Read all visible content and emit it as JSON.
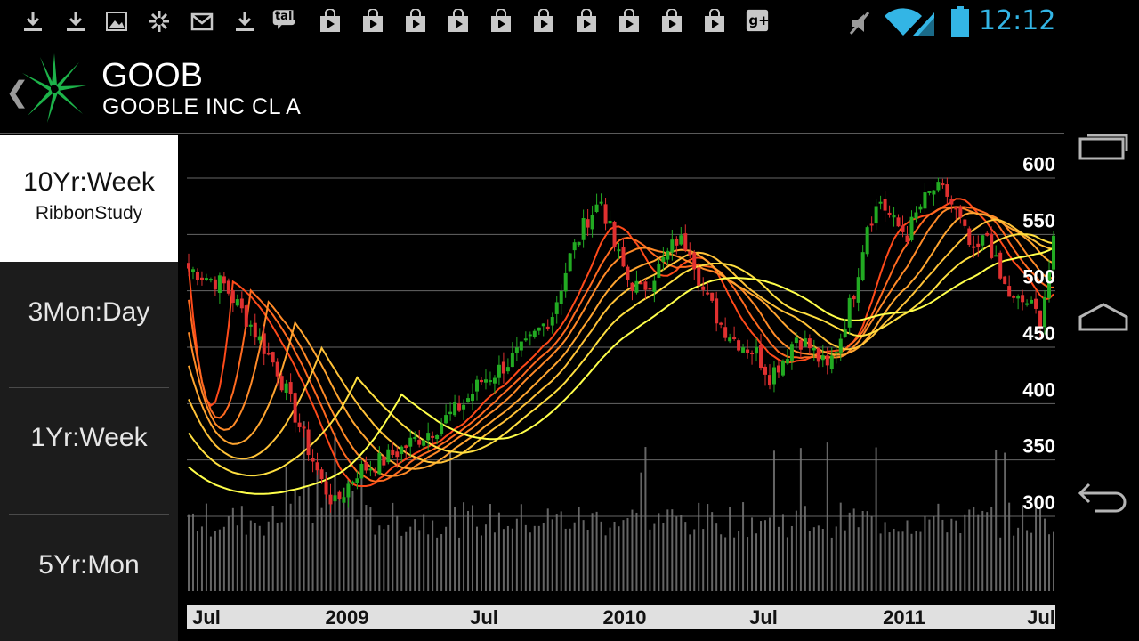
{
  "status_bar": {
    "notification_icons": [
      "download-icon",
      "download-icon",
      "image-icon",
      "pinwheel-icon",
      "gmail-icon",
      "download-icon",
      "talk-icon",
      "play-store-icon",
      "play-store-icon",
      "play-store-icon",
      "play-store-icon",
      "play-store-icon",
      "play-store-icon",
      "play-store-icon",
      "play-store-icon",
      "play-store-icon",
      "play-store-icon",
      "google-plus-icon"
    ],
    "talk_label": "talk",
    "gplus_label": "g+",
    "clock": "12:12",
    "accent_color": "#33b5e5"
  },
  "header": {
    "ticker": "GOOB",
    "company": "GOOBLE INC CL A"
  },
  "sidebar": {
    "items": [
      {
        "label": "10Yr:Week",
        "sub": "RibbonStudy",
        "active": true
      },
      {
        "label": "3Mon:Day",
        "sub": "",
        "active": false
      },
      {
        "label": "1Yr:Week",
        "sub": "",
        "active": false
      },
      {
        "label": "5Yr:Mon",
        "sub": "",
        "active": false
      }
    ]
  },
  "chart_data": {
    "type": "candlestick",
    "y_ticks": [
      "600",
      "550",
      "500",
      "450",
      "400",
      "350",
      "300"
    ],
    "ylim": [
      290,
      620
    ],
    "x_ticks": [
      "Jul",
      "2009",
      "Jul",
      "2010",
      "Jul",
      "2011",
      "Jul"
    ],
    "colors": {
      "up": "#22aa22",
      "down": "#e03030",
      "volume": "#777777",
      "grid": "#666666",
      "axis_bar": "#e0e0e0"
    },
    "ribbon_colors": [
      "#ff4a1a",
      "#ff6a20",
      "#ff8a28",
      "#ffa530",
      "#ffc238",
      "#ffdf40",
      "#ffff4a"
    ],
    "price_key_points": [
      [
        0,
        520
      ],
      [
        8,
        505
      ],
      [
        14,
        470
      ],
      [
        20,
        430
      ],
      [
        24,
        390
      ],
      [
        27,
        360
      ],
      [
        30,
        330
      ],
      [
        33,
        310
      ],
      [
        38,
        340
      ],
      [
        44,
        350
      ],
      [
        50,
        365
      ],
      [
        56,
        380
      ],
      [
        62,
        400
      ],
      [
        66,
        420
      ],
      [
        70,
        430
      ],
      [
        76,
        450
      ],
      [
        82,
        480
      ],
      [
        86,
        530
      ],
      [
        90,
        565
      ],
      [
        93,
        580
      ],
      [
        96,
        540
      ],
      [
        99,
        510
      ],
      [
        102,
        500
      ],
      [
        106,
        520
      ],
      [
        110,
        545
      ],
      [
        113,
        540
      ],
      [
        116,
        500
      ],
      [
        120,
        470
      ],
      [
        124,
        455
      ],
      [
        128,
        445
      ],
      [
        131,
        425
      ],
      [
        134,
        440
      ],
      [
        137,
        460
      ],
      [
        140,
        450
      ],
      [
        144,
        430
      ],
      [
        147,
        460
      ],
      [
        150,
        500
      ],
      [
        153,
        560
      ],
      [
        156,
        580
      ],
      [
        159,
        560
      ],
      [
        162,
        550
      ],
      [
        165,
        575
      ],
      [
        168,
        590
      ],
      [
        171,
        585
      ],
      [
        174,
        560
      ],
      [
        177,
        530
      ],
      [
        180,
        550
      ],
      [
        183,
        510
      ],
      [
        186,
        490
      ],
      [
        189,
        490
      ],
      [
        192,
        475
      ],
      [
        195,
        540
      ]
    ]
  }
}
